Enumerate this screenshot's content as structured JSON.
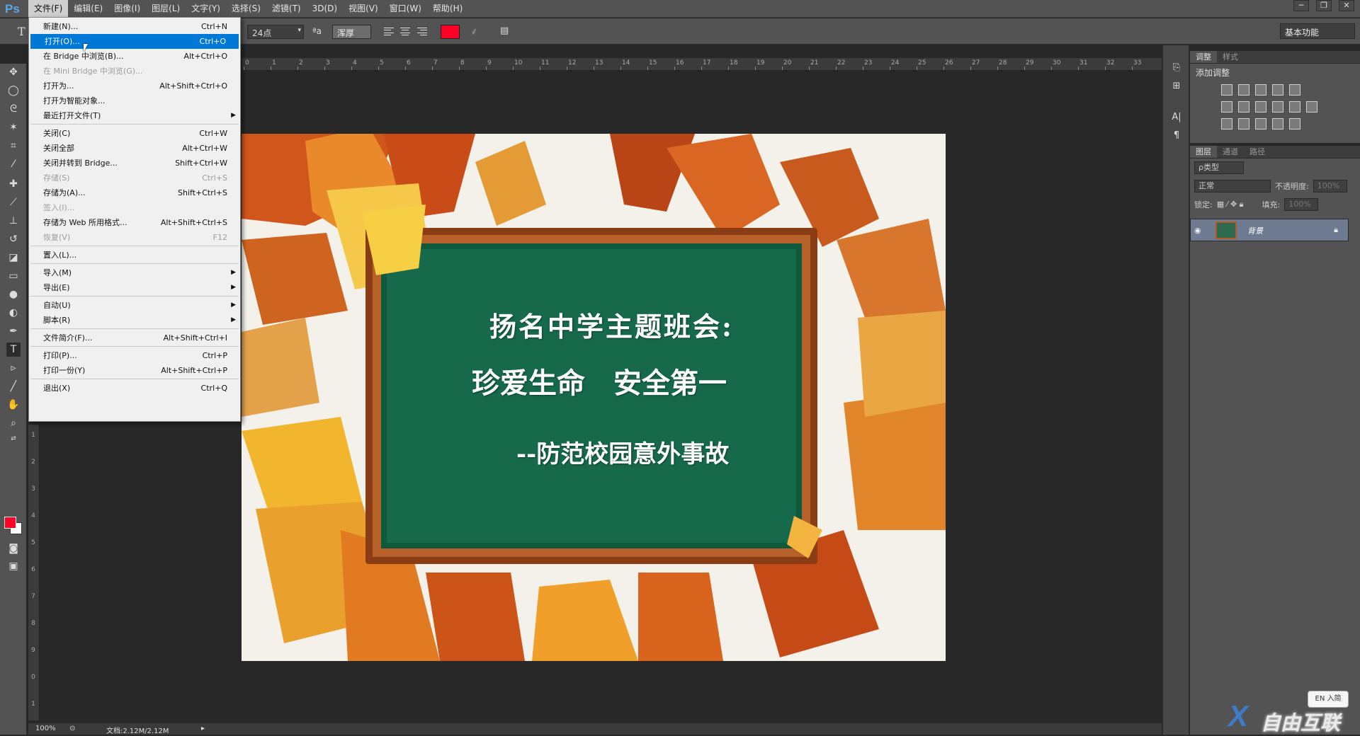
{
  "app": {
    "logo": "Ps"
  },
  "menubar": [
    "文件(F)",
    "编辑(E)",
    "图像(I)",
    "图层(L)",
    "文字(Y)",
    "选择(S)",
    "滤镜(T)",
    "3D(D)",
    "视图(V)",
    "窗口(W)",
    "帮助(H)"
  ],
  "window_controls": {
    "minimize": "─",
    "restore": "❐",
    "close": "✕"
  },
  "options": {
    "tool_icon": "T",
    "font_size": "24点",
    "aa_icon_label": "ªa",
    "aa_mode": "浑厚",
    "text_color": "#ff0026",
    "workspace": "基本功能"
  },
  "file_menu": [
    {
      "label": "新建(N)...",
      "key": "Ctrl+N"
    },
    {
      "label": "打开(O)...",
      "key": "Ctrl+O",
      "highlighted": true
    },
    {
      "label": "在 Bridge 中浏览(B)...",
      "key": "Alt+Ctrl+O"
    },
    {
      "label": "在 Mini Bridge 中浏览(G)...",
      "key": "",
      "disabled": true
    },
    {
      "label": "打开为...",
      "key": "Alt+Shift+Ctrl+O"
    },
    {
      "label": "打开为智能对象...",
      "key": ""
    },
    {
      "label": "最近打开文件(T)",
      "key": "",
      "submenu": true
    },
    {
      "label": "关闭(C)",
      "key": "Ctrl+W"
    },
    {
      "label": "关闭全部",
      "key": "Alt+Ctrl+W"
    },
    {
      "label": "关闭并转到 Bridge...",
      "key": "Shift+Ctrl+W"
    },
    {
      "label": "存储(S)",
      "key": "Ctrl+S",
      "disabled": true
    },
    {
      "label": "存储为(A)...",
      "key": "Shift+Ctrl+S"
    },
    {
      "label": "签入(I)...",
      "key": "",
      "disabled": true
    },
    {
      "label": "存储为 Web 所用格式...",
      "key": "Alt+Shift+Ctrl+S"
    },
    {
      "label": "恢复(V)",
      "key": "F12",
      "disabled": true
    },
    {
      "label": "置入(L)...",
      "key": ""
    },
    {
      "label": "导入(M)",
      "key": "",
      "submenu": true
    },
    {
      "label": "导出(E)",
      "key": "",
      "submenu": true
    },
    {
      "label": "自动(U)",
      "key": "",
      "submenu": true
    },
    {
      "label": "脚本(R)",
      "key": "",
      "submenu": true
    },
    {
      "label": "文件简介(F)...",
      "key": "Alt+Shift+Ctrl+I"
    },
    {
      "label": "打印(P)...",
      "key": "Ctrl+P"
    },
    {
      "label": "打印一份(Y)",
      "key": "Alt+Shift+Ctrl+P"
    },
    {
      "label": "退出(X)",
      "key": "Ctrl+Q"
    }
  ],
  "ruler_h": [
    "0",
    "1",
    "2",
    "3",
    "4",
    "5",
    "6",
    "7",
    "8",
    "9",
    "10",
    "11",
    "12",
    "13",
    "14",
    "15",
    "16",
    "17",
    "18",
    "19",
    "20",
    "21",
    "22",
    "23",
    "24",
    "25",
    "26",
    "27",
    "28",
    "29",
    "30",
    "31",
    "32",
    "33"
  ],
  "ruler_v": [
    "1",
    "2",
    "3",
    "4",
    "5",
    "6",
    "7",
    "8",
    "9",
    "0",
    "1"
  ],
  "document": {
    "line1": "扬名中学主题班会:",
    "line2": "珍爱生命　安全第一",
    "line3": "--防范校园意外事故"
  },
  "status": {
    "zoom": "100%",
    "doc": "文档:2.12M/2.12M"
  },
  "adjust_panel": {
    "tabs": [
      "调整",
      "样式"
    ],
    "title": "添加调整"
  },
  "layers_panel": {
    "tabs": [
      "图层",
      "通道",
      "路径"
    ],
    "filter": "ρ类型",
    "blend": "正常",
    "opacity_label": "不透明度:",
    "opacity": "100%",
    "lock_label": "锁定:",
    "fill_label": "填充:",
    "fill": "100%",
    "layer_name": "背景"
  },
  "ime": "EN 入简",
  "watermark": "自由互联"
}
